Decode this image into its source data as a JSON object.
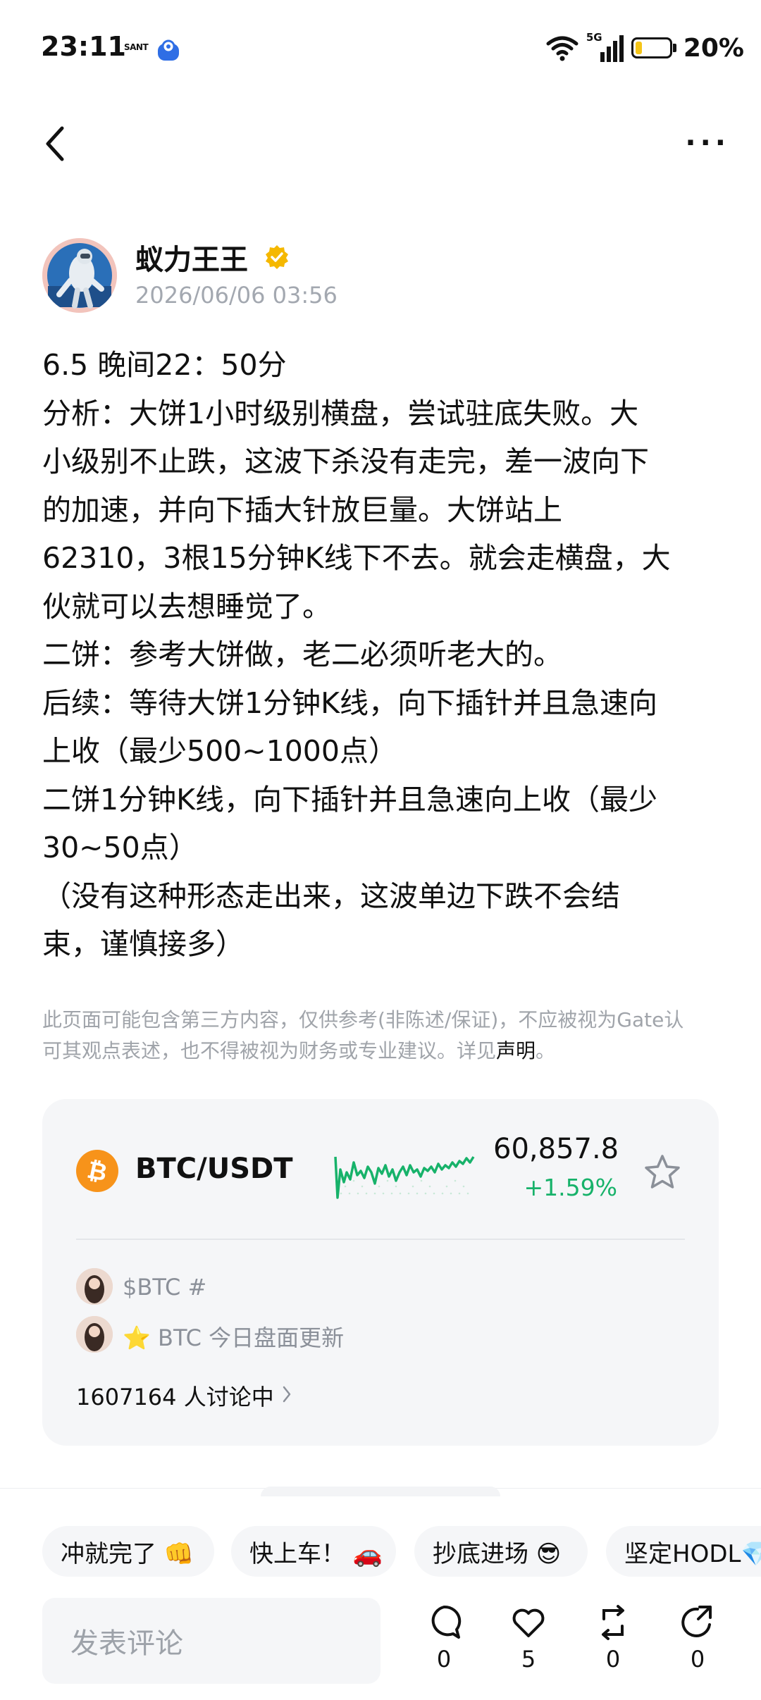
{
  "status_bar": {
    "time": "23:11",
    "app_icon_text": "SANT",
    "network": "5G",
    "battery_percent": "20%",
    "battery_level": 0.2,
    "battery_color": "#f5c518"
  },
  "nav": {
    "back_icon": "chevron-left-icon",
    "more_label": "···"
  },
  "author": {
    "name": "蚁力王王",
    "date": "2026/06/06 03:56",
    "verified_icon": "verified-badge-icon"
  },
  "post": {
    "lines": [
      "6.5  晚间22：50分",
      "分析：大饼1小时级别横盘，尝试驻底失败。大",
      "小级别不止跌，这波下杀没有走完，差一波向下",
      "的加速，并向下插大针放巨量。大饼站上",
      "62310，3根15分钟K线下不去。就会走横盘，大",
      "伙就可以去想睡觉了。",
      "二饼：参考大饼做，老二必须听老大的。",
      "后续：等待大饼1分钟K线，向下插针并且急速向",
      "上收（最少500~1000点）",
      "二饼1分钟K线，向下插针并且急速向上收（最少",
      "30~50点）",
      "（没有这种形态走出来，这波单边下跌不会结",
      "束，谨慎接多）"
    ]
  },
  "disclaimer": {
    "line1": "此页面可能包含第三方内容，仅供参考(非陈述/保证)，不应被视为Gate认",
    "line2": "可其观点表述，也不得被视为财务或专业建议。详见",
    "link": "声明",
    "end": "。"
  },
  "market_card": {
    "pair": "BTC/USDT",
    "price": "60,857.8",
    "change": "+1.59%",
    "accent_color": "#17b26a",
    "coin_color": "#f7931a",
    "feed": [
      "$BTC #",
      "⭐ BTC 今日盘面更新"
    ],
    "discussion": "1607164 人讨论中"
  },
  "quick_replies": [
    "冲就完了 👊",
    "快上车！ 🚗",
    "抄底进场 😎",
    "坚定HODL💎"
  ],
  "comment_input": {
    "placeholder": "发表评论"
  },
  "actions": {
    "comments": "0",
    "likes": "5",
    "reposts": "0",
    "shares": "0"
  }
}
